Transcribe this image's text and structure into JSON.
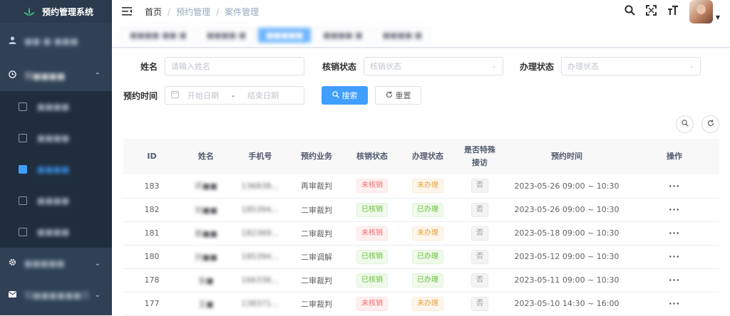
{
  "app": {
    "title": "预约管理系统"
  },
  "sidebar": {
    "user_item": "■■ ■ ■■■",
    "group1": {
      "label": "预■■■■",
      "items": [
        "■■■■",
        "■■■■",
        "■■■■",
        "■■■■",
        "■■■■"
      ]
    },
    "group2": {
      "label": "■■■■■"
    },
    "group3": {
      "label": "短■■■■■■志"
    }
  },
  "navbar": {
    "breadcrumb": [
      "首页",
      "预约管理",
      "案件管理"
    ],
    "breadcrumb_sep": "/"
  },
  "tags": [
    "■■■■ ■■ ■",
    "■■■■ ■",
    "■■■■■",
    "■■■■ ■",
    "■■■■ ■"
  ],
  "form": {
    "name_label": "姓名",
    "name_placeholder": "请输入姓名",
    "verify_label": "核销状态",
    "verify_placeholder": "核销状态",
    "handle_label": "办理状态",
    "handle_placeholder": "办理状态",
    "time_label": "预约时间",
    "start_placeholder": "开始日期",
    "range_sep": "-",
    "end_placeholder": "结束日期",
    "search_btn": "搜索",
    "reset_btn": "重置"
  },
  "table": {
    "headers": [
      "ID",
      "姓名",
      "手机号",
      "预约业务",
      "核销状态",
      "办理状态",
      "是否特殊接访",
      "预约时间",
      "操作"
    ],
    "rows": [
      {
        "id": "183",
        "name": "邓■■",
        "phone": "136838…",
        "business": "再审裁判",
        "verify": "未核销",
        "handle": "未办理",
        "special": "否",
        "time": "2023-05-26 09:00 ~ 10:30",
        "op": "···"
      },
      {
        "id": "182",
        "name": "刘■■",
        "phone": "185394…",
        "business": "二审裁判",
        "verify": "已核销",
        "handle": "已办理",
        "special": "否",
        "time": "2023-05-26 09:00 ~ 10:30",
        "op": "···"
      },
      {
        "id": "181",
        "name": "邢■■",
        "phone": "182369…",
        "business": "二审裁判",
        "verify": "未核销",
        "handle": "未办理",
        "special": "否",
        "time": "2023-05-18 09:00 ~ 10:30",
        "op": "···"
      },
      {
        "id": "180",
        "name": "刘■■",
        "phone": "185394…",
        "business": "二审调解",
        "verify": "已核销",
        "handle": "已办理",
        "special": "否",
        "time": "2023-05-12 09:00 ~ 10:30",
        "op": "···"
      },
      {
        "id": "178",
        "name": "张■",
        "phone": "166336…",
        "business": "二审裁判",
        "verify": "已核销",
        "handle": "已办理",
        "special": "否",
        "time": "2023-05-11 09:00 ~ 10:30",
        "op": "···"
      },
      {
        "id": "177",
        "name": "王■",
        "phone": "138371…",
        "business": "二审裁判",
        "verify": "未核销",
        "handle": "未办理",
        "special": "否",
        "time": "2023-05-10 14:30 ~ 16:00",
        "op": "···"
      }
    ]
  },
  "colors": {
    "sidebar": "#304156",
    "primary": "#409eff",
    "danger": "#f56c6c",
    "success": "#67c23a",
    "warning": "#e6a23c"
  },
  "icons": [
    "logo-leaf-icon",
    "user-icon",
    "clock-icon",
    "chevron-up-icon",
    "gear-icon",
    "mail-icon",
    "chevron-down-icon",
    "hamburger-icon",
    "search-icon",
    "fullscreen-icon",
    "font-size-icon",
    "calendar-icon",
    "refresh-icon"
  ]
}
